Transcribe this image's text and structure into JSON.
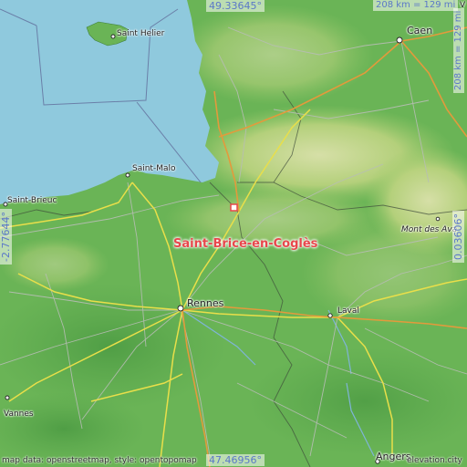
{
  "coords": {
    "top": "49.33645°",
    "bottom": "47.46956°",
    "left": "-2.77644°",
    "right": "0.03606°"
  },
  "scale": {
    "top": "208 km = 129 mi",
    "right": "208 km = 129 mi"
  },
  "cities": {
    "caen": "Caen",
    "saint_helier": "Saint Helier",
    "saint_malo": "Saint-Malo",
    "saint_brieuc": "Saint-Brieuc",
    "rennes": "Rennes",
    "laval": "Laval",
    "vannes": "Vannes",
    "angers": "Angers",
    "mont_des_avaloirs": "Mont des Ava",
    "partial_top": "V"
  },
  "highlight": "Saint-Brice-en-Coglès",
  "attribution": {
    "left": "map data: openstreetmap, style: opentopomap",
    "right": "elevation.city"
  },
  "colors": {
    "sea": "#8fc9dd",
    "lowland": "#5aa74a",
    "upland": "#c8d68a",
    "highlight": "#e8474c",
    "coord_text": "#5b78c8"
  }
}
